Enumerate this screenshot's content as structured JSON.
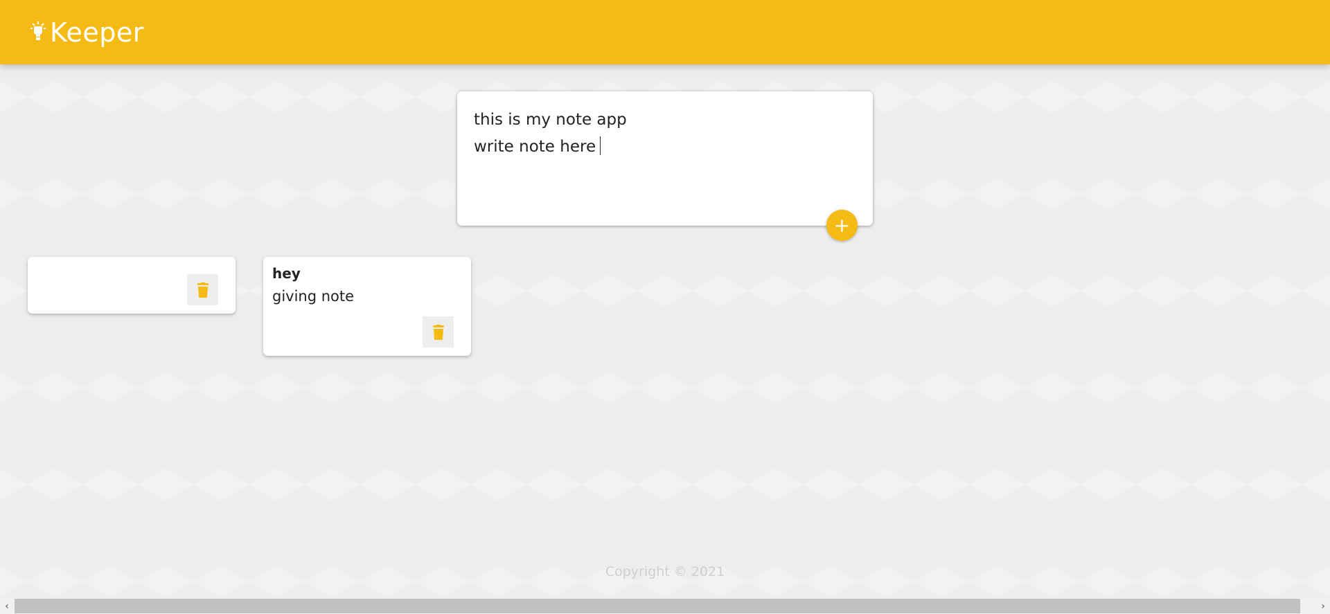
{
  "header": {
    "title": "Keeper",
    "icon": "lightbulb-icon",
    "color": "#f5ba13"
  },
  "create_note": {
    "title_value": "this is my note app",
    "content_value": "write note here",
    "add_icon": "plus-icon",
    "add_symbol": "+"
  },
  "notes": [
    {
      "title": "",
      "content": "",
      "delete_icon": "trash-icon"
    },
    {
      "title": "hey",
      "content": "giving note",
      "delete_icon": "trash-icon"
    }
  ],
  "footer": {
    "text": "Copyright © 2021"
  },
  "scrollbar": {
    "left_arrow": "‹",
    "right_arrow": "›"
  }
}
